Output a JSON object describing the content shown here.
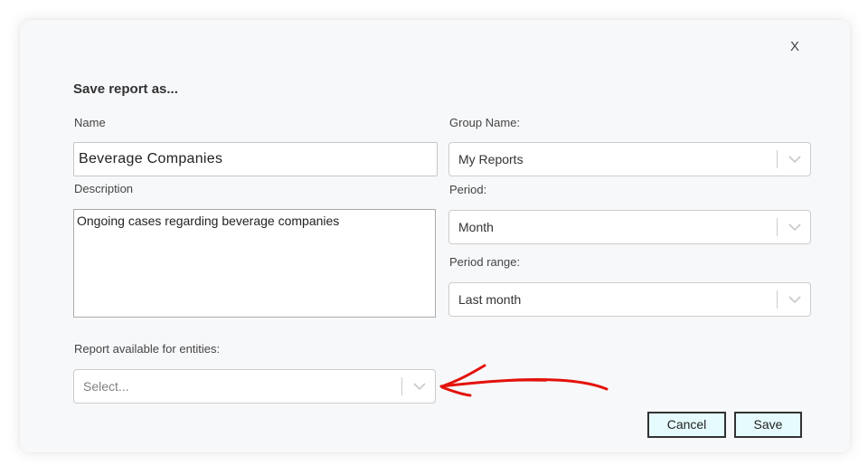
{
  "dialog": {
    "title": "Save report as...",
    "close_label": "X"
  },
  "form": {
    "name_label": "Name",
    "name_value": "Beverage Companies",
    "description_label": "Description",
    "description_value": "Ongoing cases regarding beverage companies",
    "group_label": "Group Name:",
    "group_value": "My Reports",
    "period_label": "Period:",
    "period_value": "Month",
    "period_range_label": "Period range:",
    "period_range_value": "Last month",
    "entities_label": "Report available for entities:",
    "entities_placeholder": "Select..."
  },
  "buttons": {
    "cancel_label": "Cancel",
    "save_label": "Save"
  },
  "icons": {
    "dropdown": "chevron-down-icon",
    "annotation": "red-arrow-annotation"
  },
  "colors": {
    "button_bg": "#e6fbfd",
    "annotation": "#e3120b"
  }
}
